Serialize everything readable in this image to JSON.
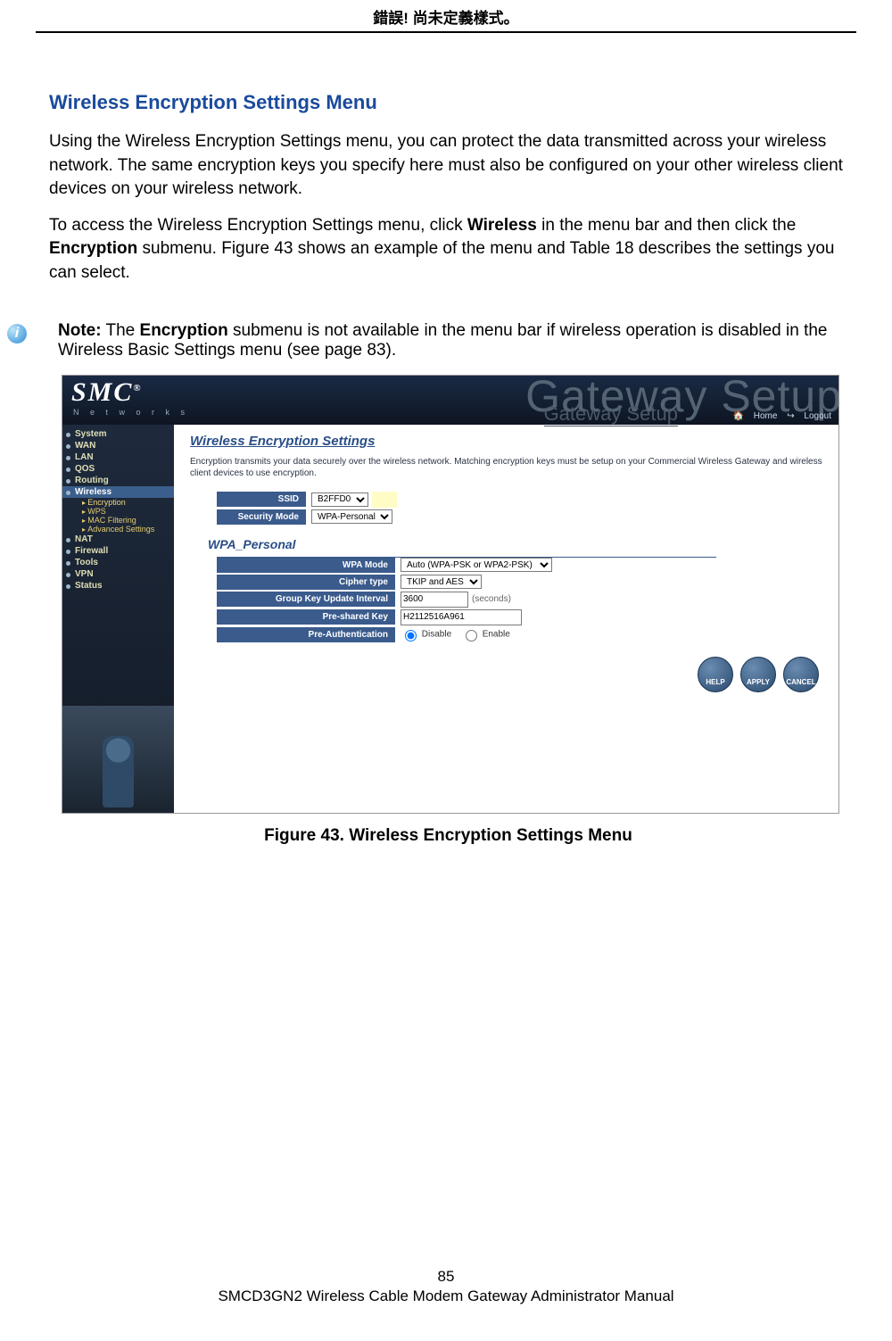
{
  "header": {
    "error_text": "錯誤! 尚未定義樣式。"
  },
  "doc": {
    "section_title": "Wireless Encryption Settings Menu",
    "para1": "Using the Wireless Encryption Settings menu, you can protect the data transmitted across your wireless network. The same encryption keys you specify here must also be configured on your other wireless client devices on your wireless network.",
    "para2_a": "To access the Wireless Encryption Settings menu, click ",
    "para2_b": "Wireless",
    "para2_c": " in the menu bar and then click the ",
    "para2_d": "Encryption",
    "para2_e": " submenu. Figure 43 shows an example of the menu and Table 18 describes the settings you can select.",
    "note_label": "Note:",
    "note_a": " The ",
    "note_b": "Encryption",
    "note_c": " submenu is not available in the menu bar if wireless operation is disabled in the Wireless Basic Settings menu (see page 83).",
    "figure_caption": "Figure 43. Wireless Encryption Settings Menu"
  },
  "screenshot": {
    "logo": "SMC",
    "logo_sub": "N e t w o r k s",
    "watermark": "Gateway Setup",
    "gateway": "Gateway Setup",
    "home": "Home",
    "logout": "Logout",
    "nav": {
      "system": "System",
      "wan": "WAN",
      "lan": "LAN",
      "qos": "QOS",
      "routing": "Routing",
      "wireless": "Wireless",
      "encryption": "Encryption",
      "wps": "WPS",
      "mac": "MAC Filtering",
      "advanced": "Advanced Settings",
      "nat": "NAT",
      "firewall": "Firewall",
      "tools": "Tools",
      "vpn": "VPN",
      "status": "Status"
    },
    "page_title": "Wireless Encryption Settings",
    "intro": "Encryption transmits your data securely over the wireless network. Matching encryption keys must be setup on your Commercial Wireless Gateway and wireless client devices to use encryption.",
    "labels": {
      "ssid": "SSID",
      "security_mode": "Security Mode",
      "wpa_personal": "WPA_Personal",
      "wpa_mode": "WPA Mode",
      "cipher": "Cipher type",
      "group_key": "Group Key Update Interval",
      "psk": "Pre-shared Key",
      "preauth": "Pre-Authentication"
    },
    "values": {
      "ssid": "B2FFD0",
      "security_mode": "WPA-Personal",
      "wpa_mode": "Auto (WPA-PSK or WPA2-PSK)",
      "cipher": "TKIP and AES",
      "group_key": "3600",
      "group_key_unit": "(seconds)",
      "psk": "H2112516A961",
      "disable": "Disable",
      "enable": "Enable"
    },
    "buttons": {
      "help": "HELP",
      "apply": "APPLY",
      "cancel": "CANCEL"
    }
  },
  "footer": {
    "page_num": "85",
    "manual": "SMCD3GN2 Wireless Cable Modem Gateway Administrator Manual"
  }
}
